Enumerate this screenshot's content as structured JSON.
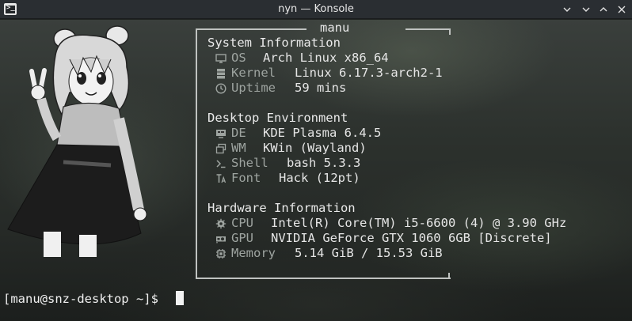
{
  "window": {
    "title": "nyn — Konsole",
    "controls": {
      "pin": "⌄",
      "minimize": "⌄",
      "maximize": "⌃",
      "close": "✕"
    }
  },
  "fetch": {
    "user": "manu",
    "system": {
      "header": "System Information",
      "rows": [
        {
          "icon": "monitor-icon",
          "label": "OS",
          "value": "Arch Linux x86_64"
        },
        {
          "icon": "server-icon",
          "label": "Kernel",
          "value": "Linux 6.17.3-arch2-1"
        },
        {
          "icon": "clock-icon",
          "label": "Uptime",
          "value": "59 mins"
        }
      ]
    },
    "desktop": {
      "header": "Desktop Environment",
      "rows": [
        {
          "icon": "desktop-icon",
          "label": "DE",
          "value": "KDE Plasma 6.4.5"
        },
        {
          "icon": "windows-icon",
          "label": "WM",
          "value": "KWin (Wayland)"
        },
        {
          "icon": "terminal-icon",
          "label": "Shell",
          "value": "bash 5.3.3"
        },
        {
          "icon": "font-icon",
          "label": "Font",
          "value": "Hack (12pt)"
        }
      ]
    },
    "hardware": {
      "header": "Hardware Information",
      "rows": [
        {
          "icon": "cpu-icon",
          "label": "CPU",
          "value": "Intel(R) Core(TM) i5-6600 (4) @ 3.90 GHz"
        },
        {
          "icon": "gpu-icon",
          "label": "GPU",
          "value": "NVIDIA GeForce GTX 1060 6GB [Discrete]"
        },
        {
          "icon": "memory-icon",
          "label": "Memory",
          "value": "5.14 GiB / 15.53 GiB"
        }
      ]
    }
  },
  "prompt": "[manu@snz-desktop ~]$"
}
